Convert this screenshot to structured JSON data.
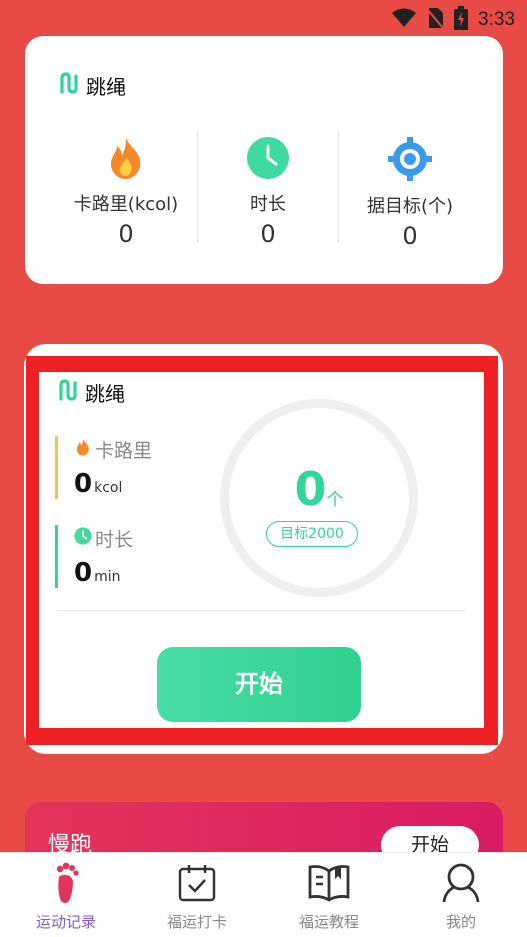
{
  "status_bar": {
    "time": "3:33"
  },
  "summary_card": {
    "title": "跳绳",
    "stats": [
      {
        "label": "卡路里(kcol)",
        "value": "0",
        "icon": "flame-icon"
      },
      {
        "label": "时长",
        "value": "0",
        "icon": "clock-icon"
      },
      {
        "label": "据目标(个)",
        "value": "0",
        "icon": "target-icon"
      }
    ]
  },
  "jump_card": {
    "title": "跳绳",
    "calories": {
      "label": "卡路里",
      "value": "0",
      "unit": "kcol"
    },
    "duration": {
      "label": "时长",
      "value": "0",
      "unit": "min"
    },
    "count": {
      "value": "0",
      "unit": "个"
    },
    "goal_label": "目标2000",
    "start_button": "开始"
  },
  "run_card": {
    "label": "慢跑",
    "start_button": "开始"
  },
  "tabbar": {
    "items": [
      {
        "label": "运动记录",
        "icon": "footprint-icon",
        "active": true
      },
      {
        "label": "福运打卡",
        "icon": "calendar-check-icon",
        "active": false
      },
      {
        "label": "福运教程",
        "icon": "book-icon",
        "active": false
      },
      {
        "label": "我的",
        "icon": "person-icon",
        "active": false
      }
    ]
  },
  "colors": {
    "background": "#E84A45",
    "accent_green": "#2ED69A",
    "highlight_border": "#ED2124",
    "active_tab": "#7B5CD6"
  }
}
